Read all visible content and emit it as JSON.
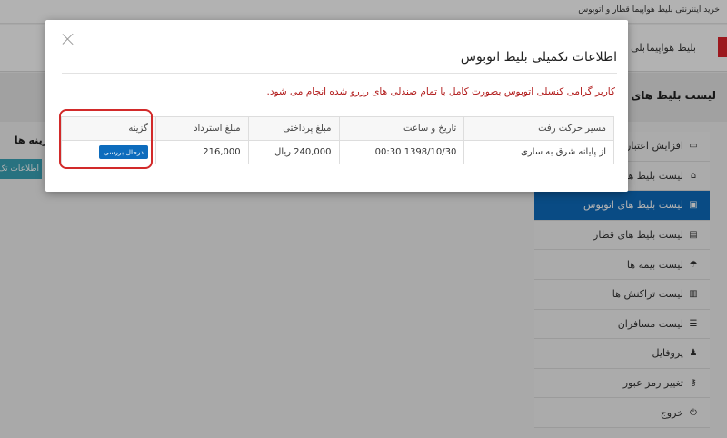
{
  "topbar": {
    "text": "خرید اینترنتی بلیط هواپیما قطار و اتوبوس"
  },
  "navbar": {
    "items": [
      "بلیط هواپیما",
      "بلی"
    ]
  },
  "page": {
    "title": "لیست بلیط های اتوب",
    "content_heading": "گزینه ها",
    "content_button": "اطلاعات تک"
  },
  "sidebar": {
    "items": [
      {
        "label": "افزایش اعتبار",
        "icon": "▭"
      },
      {
        "label": "لیست بلیط ها",
        "icon": "⌂"
      },
      {
        "label": "لیست بلیط های اتوبوس",
        "icon": "▣"
      },
      {
        "label": "لیست بلیط های قطار",
        "icon": "▤"
      },
      {
        "label": "لیست بیمه ها",
        "icon": "☂"
      },
      {
        "label": "لیست تراکنش ها",
        "icon": "▥"
      },
      {
        "label": "لیست مسافران",
        "icon": "☰"
      },
      {
        "label": "پروفایل",
        "icon": "♟"
      },
      {
        "label": "تغییر رمز عبور",
        "icon": "⚷"
      },
      {
        "label": "خروج",
        "icon": "⏻"
      }
    ]
  },
  "modal": {
    "title": "اطلاعات تکمیلی بلیط اتوبوس",
    "warning": "کاربر گرامی کنسلی اتوبوس بصورت کامل با تمام صندلی های رزرو شده انجام می شود.",
    "columns": [
      "مسیر حرکت رفت",
      "تاریخ و ساعت",
      "مبلغ پرداختی",
      "مبلغ استرداد",
      "گزینه"
    ],
    "row": {
      "route": "از پایانه شرق به ساری",
      "datetime": "1398/10/30  00:30",
      "paid": "240,000 ریال",
      "refund": "216,000",
      "status_button": "درحال بررسی"
    }
  },
  "colors": {
    "accent": "#0d6cbd",
    "warning": "#b11a1a",
    "highlight": "#d22a2a",
    "teal": "#3aa4b8"
  }
}
